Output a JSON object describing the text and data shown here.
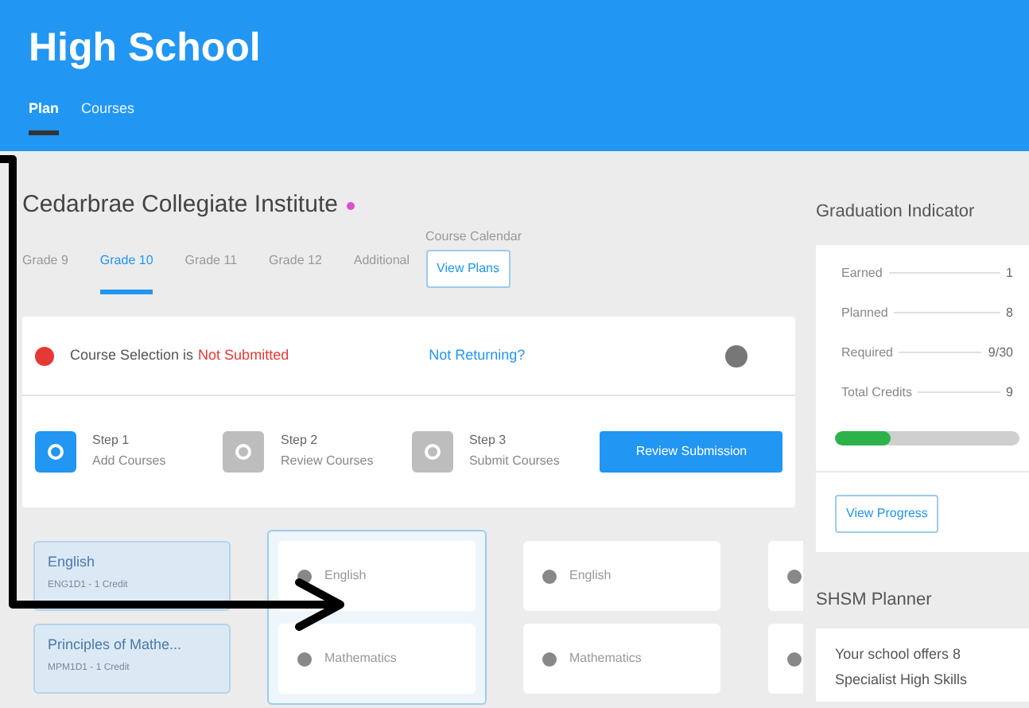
{
  "app_bar": {
    "title": "High School",
    "tabs": [
      {
        "label": "Plan",
        "selected": true
      },
      {
        "label": "Courses",
        "selected": false
      }
    ]
  },
  "school": {
    "name": "Cedarbrae Collegiate Institute",
    "color": "#d94fd0"
  },
  "grade_tabs": [
    {
      "label": "Grade 9",
      "selected": false
    },
    {
      "label": "Grade 10",
      "selected": true
    },
    {
      "label": "Grade 11",
      "selected": false
    },
    {
      "label": "Grade 12",
      "selected": false
    },
    {
      "label": "Additional",
      "selected": false
    }
  ],
  "calendar": {
    "label": "Course Calendar",
    "button": "View Plans"
  },
  "status": {
    "label": "Course Selection is",
    "value": "Not Submitted",
    "link": "Not Returning?"
  },
  "steps": [
    {
      "title": "Step 1",
      "caption": "Add Courses",
      "active": true
    },
    {
      "title": "Step 2",
      "caption": "Review Courses",
      "active": false
    },
    {
      "title": "Step 3",
      "caption": "Submit Courses",
      "active": false
    }
  ],
  "review_button": "Review Submission",
  "course_columns": [
    {
      "highlighted": false,
      "items": [
        {
          "kind": "chosen",
          "title": "English",
          "subtitle": "ENG1D1 - 1 Credit"
        },
        {
          "kind": "chosen",
          "title": "Principles of Mathe...",
          "subtitle": "MPM1D1 - 1 Credit"
        }
      ]
    },
    {
      "highlighted": true,
      "items": [
        {
          "kind": "add",
          "title": "English"
        },
        {
          "kind": "add",
          "title": "Mathematics"
        }
      ]
    },
    {
      "highlighted": false,
      "items": [
        {
          "kind": "add",
          "title": "English"
        },
        {
          "kind": "add",
          "title": "Mathematics"
        }
      ]
    },
    {
      "highlighted": false,
      "items": [
        {
          "kind": "add"
        },
        {
          "kind": "add"
        }
      ]
    }
  ],
  "graduation": {
    "title": "Graduation Indicator",
    "rows": [
      {
        "label": "Earned",
        "value": "1"
      },
      {
        "label": "Planned",
        "value": "8"
      },
      {
        "label": "Required",
        "value": "9/30"
      },
      {
        "label": "Total Credits",
        "value": "9"
      }
    ],
    "level": 0.3,
    "button": "View Progress"
  },
  "shsm": {
    "title": "SHSM Planner",
    "text": "Your school offers 8 Specialist High Skills"
  },
  "annotation": {
    "kind": "arrow"
  }
}
